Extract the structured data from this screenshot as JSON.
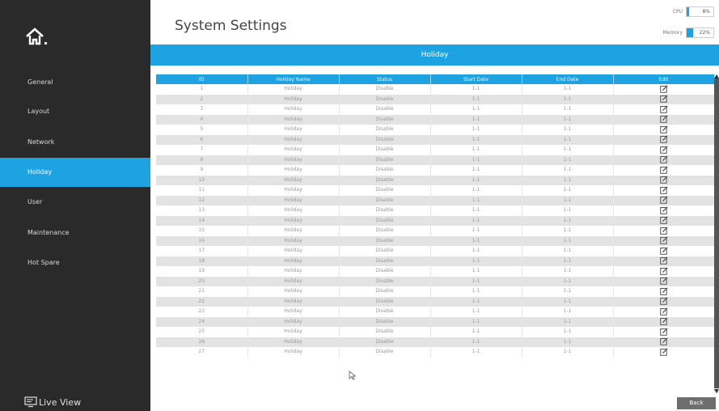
{
  "header": {
    "title": "System Settings"
  },
  "meters": {
    "cpu": {
      "label": "CPU",
      "value": "8%",
      "fraction": 0.08
    },
    "memory": {
      "label": "Memory",
      "value": "22%",
      "fraction": 0.22
    }
  },
  "sidebar": {
    "items": [
      {
        "label": "General"
      },
      {
        "label": "Layout"
      },
      {
        "label": "Network"
      },
      {
        "label": "Holiday",
        "active": true
      },
      {
        "label": "User"
      },
      {
        "label": "Maintenance"
      },
      {
        "label": "Hot Spare"
      }
    ],
    "live_view": "Live View"
  },
  "section": {
    "title": "Holiday"
  },
  "table": {
    "columns": [
      "ID",
      "Holiday Name",
      "Status",
      "Start Date",
      "End Date",
      "Edit"
    ],
    "rows": [
      [
        "1",
        "Holiday",
        "Disable",
        "1-1",
        "1-1"
      ],
      [
        "2",
        "Holiday",
        "Disable",
        "1-1",
        "1-1"
      ],
      [
        "3",
        "Holiday",
        "Disable",
        "1-1",
        "1-1"
      ],
      [
        "4",
        "Holiday",
        "Disable",
        "1-1",
        "1-1"
      ],
      [
        "5",
        "Holiday",
        "Disable",
        "1-1",
        "1-1"
      ],
      [
        "6",
        "Holiday",
        "Disable",
        "1-1",
        "1-1"
      ],
      [
        "7",
        "Holiday",
        "Disable",
        "1-1",
        "1-1"
      ],
      [
        "8",
        "Holiday",
        "Disable",
        "1-1",
        "1-1"
      ],
      [
        "9",
        "Holiday",
        "Disable",
        "1-1",
        "1-1"
      ],
      [
        "10",
        "Holiday",
        "Disable",
        "1-1",
        "1-1"
      ],
      [
        "11",
        "Holiday",
        "Disable",
        "1-1",
        "1-1"
      ],
      [
        "12",
        "Holiday",
        "Disable",
        "1-1",
        "1-1"
      ],
      [
        "13",
        "Holiday",
        "Disable",
        "1-1",
        "1-1"
      ],
      [
        "14",
        "Holiday",
        "Disable",
        "1-1",
        "1-1"
      ],
      [
        "15",
        "Holiday",
        "Disable",
        "1-1",
        "1-1"
      ],
      [
        "16",
        "Holiday",
        "Disable",
        "1-1",
        "1-1"
      ],
      [
        "17",
        "Holiday",
        "Disable",
        "1-1",
        "1-1"
      ],
      [
        "18",
        "Holiday",
        "Disable",
        "1-1",
        "1-1"
      ],
      [
        "19",
        "Holiday",
        "Disable",
        "1-1",
        "1-1"
      ],
      [
        "20",
        "Holiday",
        "Disable",
        "1-1",
        "1-1"
      ],
      [
        "21",
        "Holiday",
        "Disable",
        "1-1",
        "1-1"
      ],
      [
        "22",
        "Holiday",
        "Disable",
        "1-1",
        "1-1"
      ],
      [
        "23",
        "Holiday",
        "Disable",
        "1-1",
        "1-1"
      ],
      [
        "24",
        "Holiday",
        "Disable",
        "1-1",
        "1-1"
      ],
      [
        "25",
        "Holiday",
        "Disable",
        "1-1",
        "1-1"
      ],
      [
        "26",
        "Holiday",
        "Disable",
        "1-1",
        "1-1"
      ],
      [
        "27",
        "Holiday",
        "Disable",
        "1-1",
        "1-1"
      ]
    ]
  },
  "footer": {
    "back_label": "Back"
  },
  "colors": {
    "accent": "#1da3e1",
    "sidebar_bg": "#2a2a2a",
    "row_alt": "#e3e3e3"
  }
}
